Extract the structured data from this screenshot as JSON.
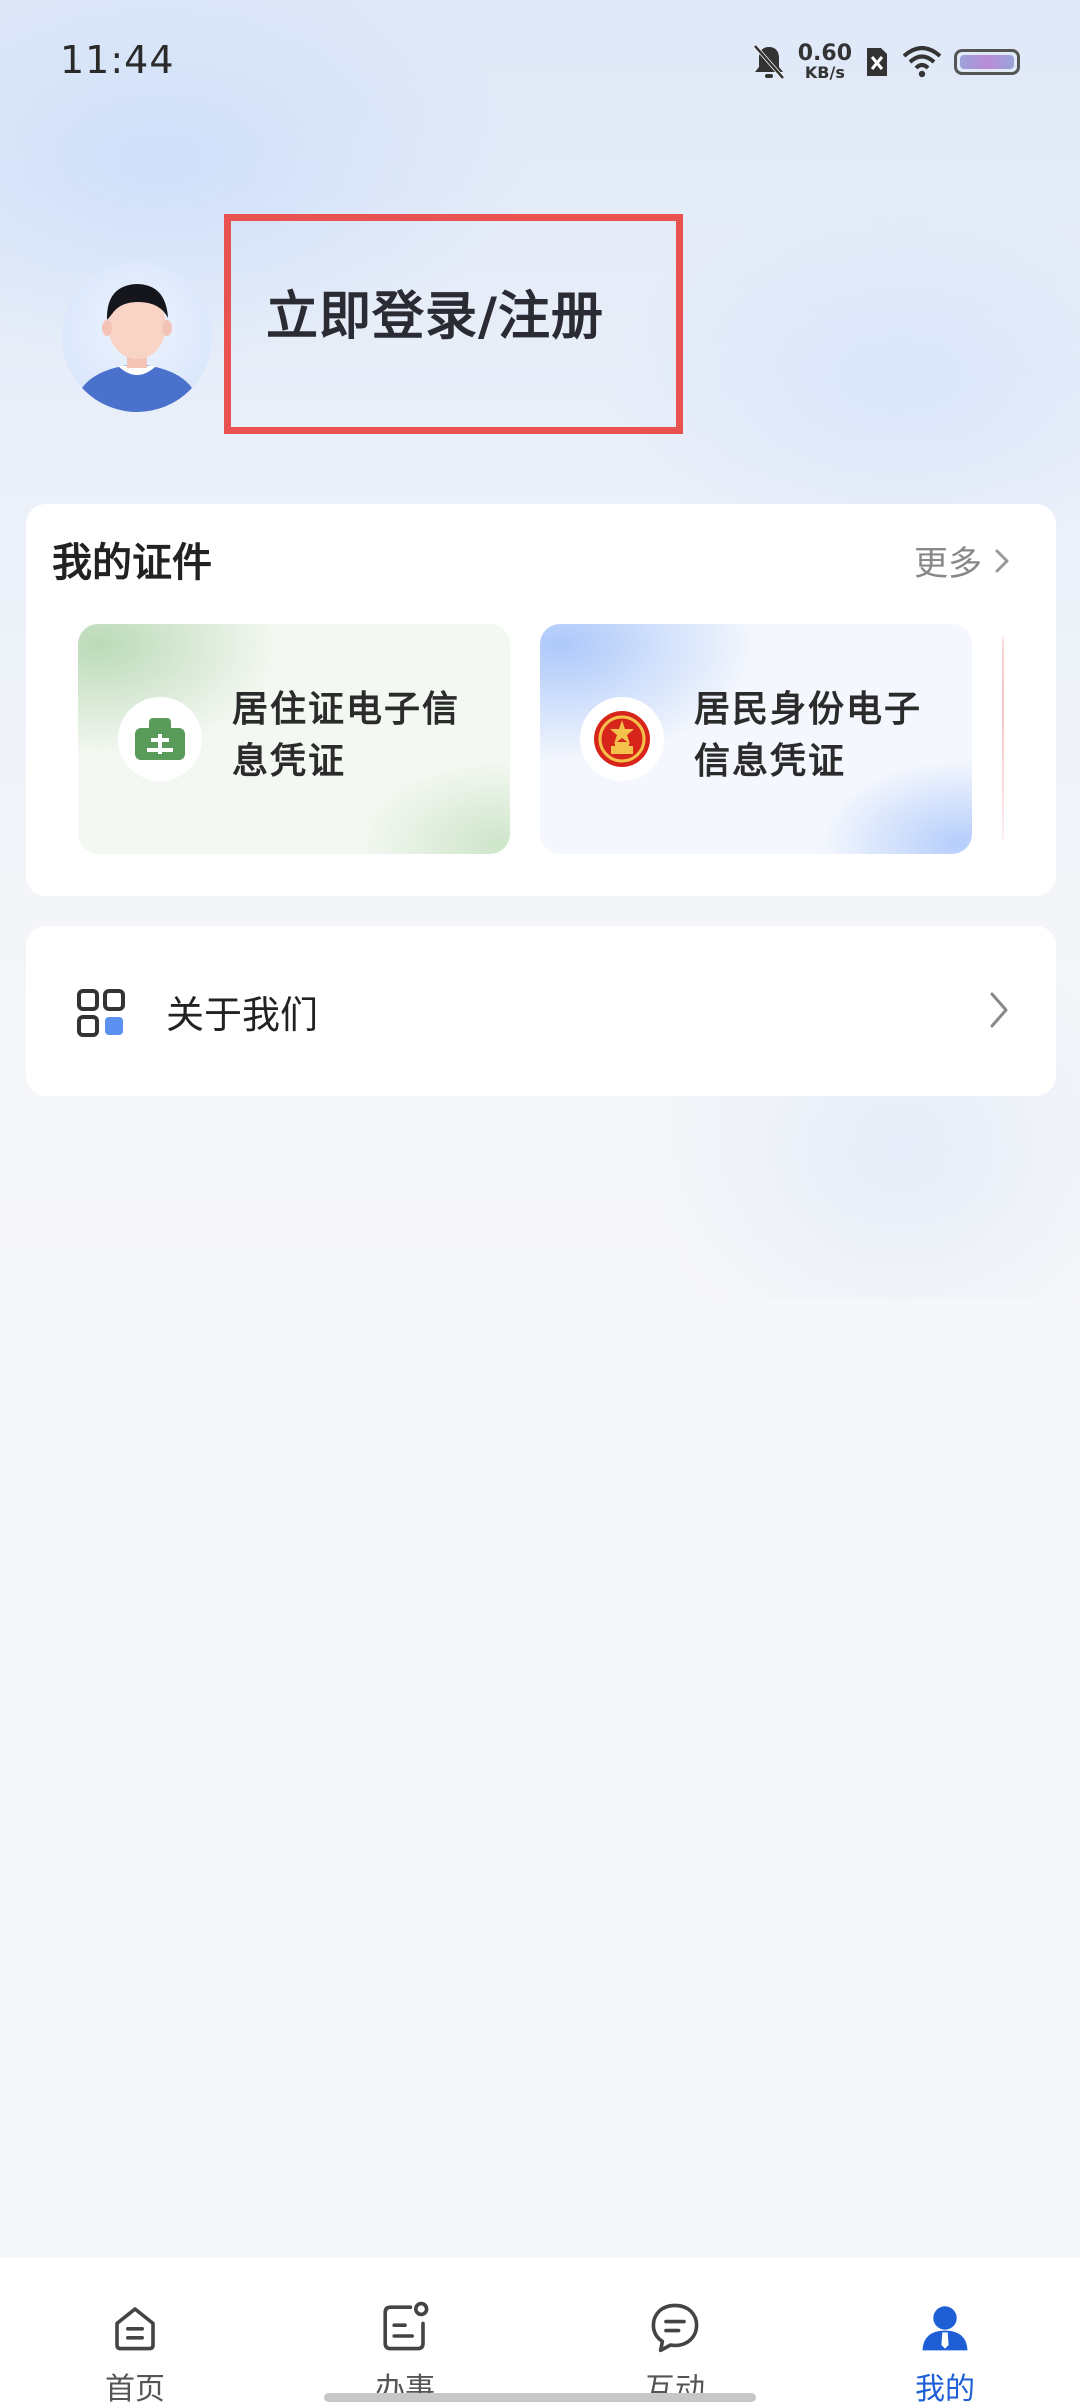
{
  "status_bar": {
    "time": "11:44",
    "net_speed_value": "0.60",
    "net_speed_unit": "KB/s",
    "icons": [
      "bell-muted-icon",
      "sim-x-icon",
      "wifi-icon",
      "battery-icon"
    ]
  },
  "profile": {
    "login_label": "立即登录/注册",
    "avatar_icon": "default-avatar-icon"
  },
  "certificates": {
    "title": "我的证件",
    "more_label": "更多",
    "items": [
      {
        "label": "居住证电子信息凭证",
        "icon": "residence-permit-icon",
        "color": "#5a9a5a"
      },
      {
        "label": "居民身份电子信息凭证",
        "icon": "national-emblem-icon",
        "color": "#d8251c"
      },
      {
        "label": "",
        "icon": "partial-card-icon",
        "color": "#f0b9bb"
      }
    ]
  },
  "menu": {
    "about_label": "关于我们"
  },
  "tabbar": {
    "active_color": "#1f5fd6",
    "tabs": [
      {
        "label": "首页",
        "icon": "home-icon",
        "active": false
      },
      {
        "label": "办事",
        "icon": "affairs-icon",
        "active": false
      },
      {
        "label": "互动",
        "icon": "chat-icon",
        "active": false
      },
      {
        "label": "我的",
        "icon": "person-icon",
        "active": true
      }
    ]
  }
}
